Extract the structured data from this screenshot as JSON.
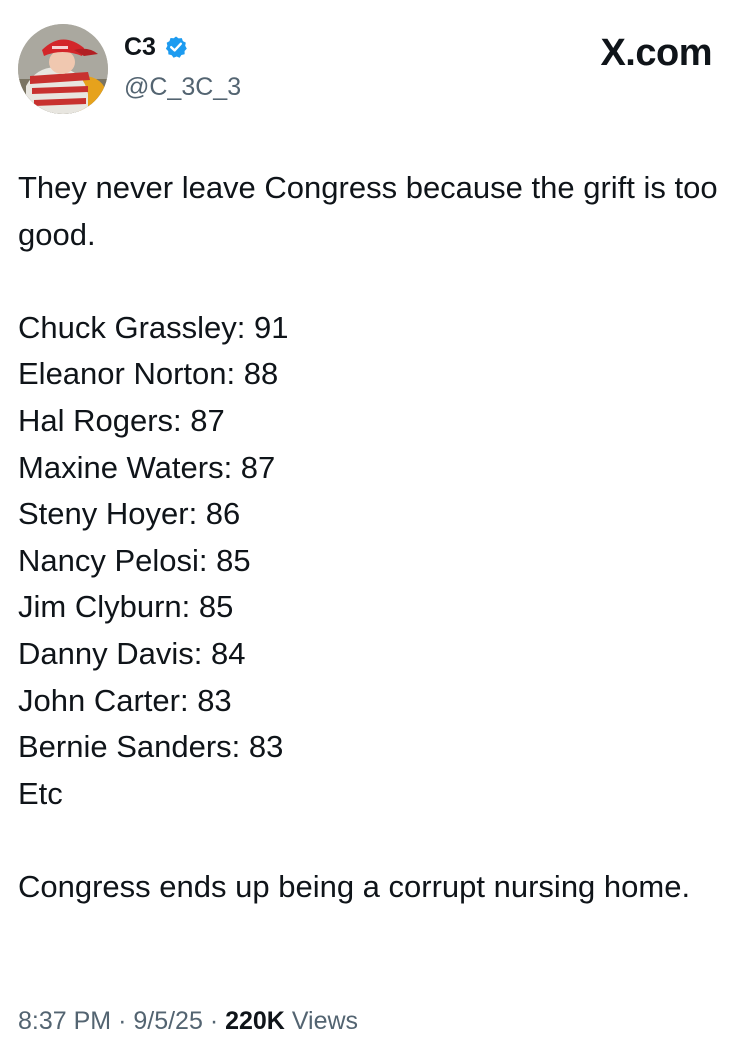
{
  "author": {
    "display_name": "C3",
    "handle": "@C_3C_3",
    "verified": true,
    "avatar_icon": "avatar-photo-child-red-cap"
  },
  "brand": "X.com",
  "colors": {
    "text": "#0f1419",
    "secondary": "#536471",
    "verified_blue": "#1d9bf0"
  },
  "tweet": {
    "intro": "They never leave Congress because the grift is too good.",
    "list": [
      "Chuck Grassley: 91",
      "Eleanor Norton: 88",
      "Hal Rogers: 87",
      "Maxine Waters: 87",
      "Steny Hoyer: 86",
      "Nancy Pelosi: 85",
      "Jim Clyburn: 85",
      "Danny Davis: 84",
      "John Carter: 83",
      "Bernie Sanders: 83",
      "Etc"
    ],
    "closing": "Congress ends up being a corrupt nursing home."
  },
  "meta": {
    "time": "8:37 PM",
    "separator": "·",
    "date": "9/5/25",
    "views_count": "220K",
    "views_label": "Views"
  }
}
